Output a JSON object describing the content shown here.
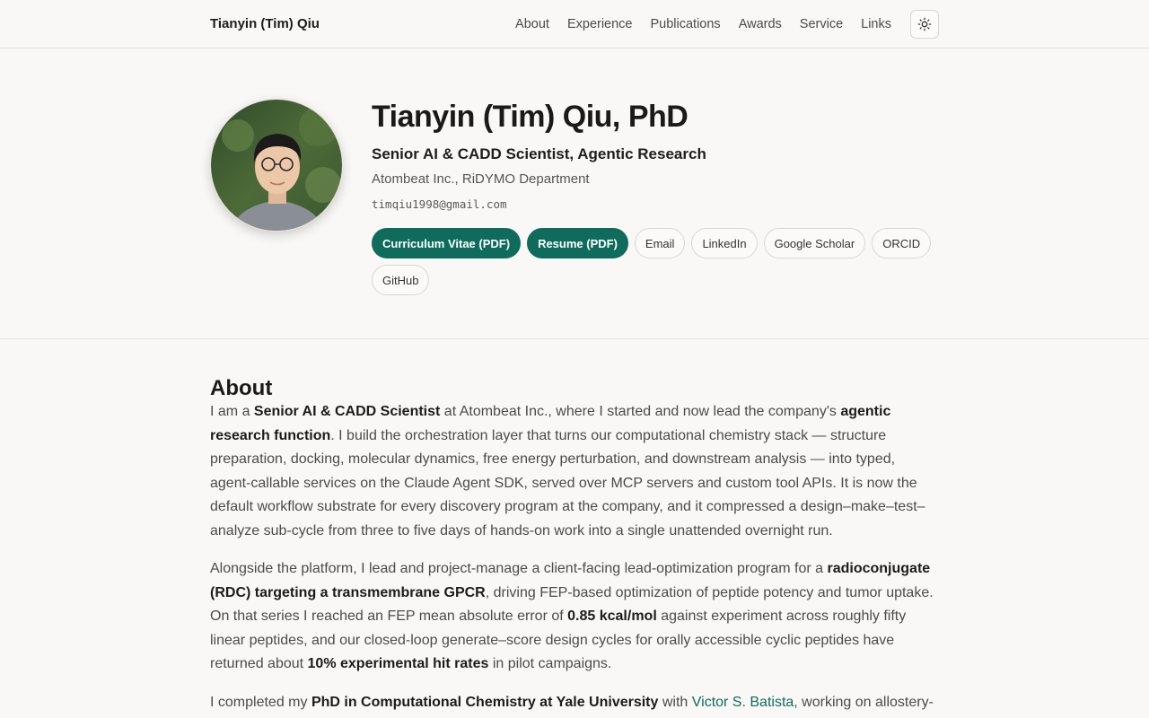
{
  "header": {
    "brand": "Tianyin (Tim) Qiu",
    "nav": [
      "About",
      "Experience",
      "Publications",
      "Awards",
      "Service",
      "Links"
    ],
    "theme_toggle_icon": "sun-icon"
  },
  "hero": {
    "name": "Tianyin (Tim) Qiu, PhD",
    "title": "Senior AI & CADD Scientist, Agentic Research",
    "org": "Atombeat Inc., RiDYMO Department",
    "email": "timqiu1998@gmail.com",
    "buttons": {
      "cv": "Curriculum Vitae (PDF)",
      "resume": "Resume (PDF)",
      "email": "Email",
      "linkedin": "LinkedIn",
      "scholar": "Google Scholar",
      "orcid": "ORCID",
      "github": "GitHub"
    },
    "accent_color": "#0f6b5c"
  },
  "about": {
    "heading": "About",
    "p1": {
      "t1": "I am a ",
      "b1": "Senior AI & CADD Scientist",
      "t2": " at Atombeat Inc., where I started and now lead the company's ",
      "b2": "agentic research function",
      "t3": ". I build the orchestration layer that turns our computational chemistry stack — structure preparation, docking, molecular dynamics, free energy perturbation, and downstream analysis — into typed, agent-callable services on the Claude Agent SDK, served over MCP servers and custom tool APIs. It is now the default workflow substrate for every discovery program at the company, and it compressed a design–make–test–analyze sub-cycle from three to five days of hands-on work into a single unattended overnight run."
    },
    "p2": {
      "t1": "Alongside the platform, I lead and project-manage a client-facing lead-optimization program for a ",
      "b1": "radioconjugate (RDC) targeting a transmembrane GPCR",
      "t2": ", driving FEP-based optimization of peptide potency and tumor uptake. On that series I reached an FEP mean absolute error of ",
      "b2": "0.85 kcal/mol",
      "t3": " against experiment across roughly fifty linear peptides, and our closed-loop generate–score design cycles for orally accessible cyclic peptides have returned about ",
      "b3": "10% experimental hit rates",
      "t4": " in pilot campaigns."
    },
    "p3": {
      "t1": "I completed my ",
      "b1": "PhD in Computational Chemistry at Yale University",
      "t2": " with ",
      "link": "Victor S. Batista",
      "t3": ", working on allostery-"
    }
  }
}
